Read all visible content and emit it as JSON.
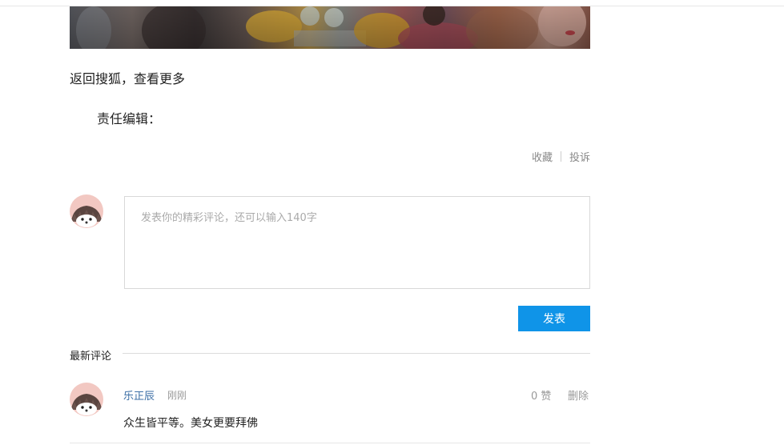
{
  "article": {
    "back_link": "返回搜狐，查看更多",
    "editor_label": "责任编辑：",
    "actions": {
      "favorite": "收藏",
      "report": "投诉"
    }
  },
  "comment_form": {
    "placeholder": "发表你的精彩评论，还可以输入140字",
    "submit_label": "发表"
  },
  "comments": {
    "section_title": "最新评论",
    "items": [
      {
        "user": "乐正辰",
        "time": "刚刚",
        "likes": "0 赞",
        "delete_label": "删除",
        "text": "众生皆平等。美女更要拜佛"
      }
    ]
  },
  "colors": {
    "accent": "#0f94e8",
    "username": "#3b6ea5",
    "avatar_bg": "#f2c8c2"
  },
  "icons": {
    "avatar": "hedgehog-avatar-icon"
  }
}
